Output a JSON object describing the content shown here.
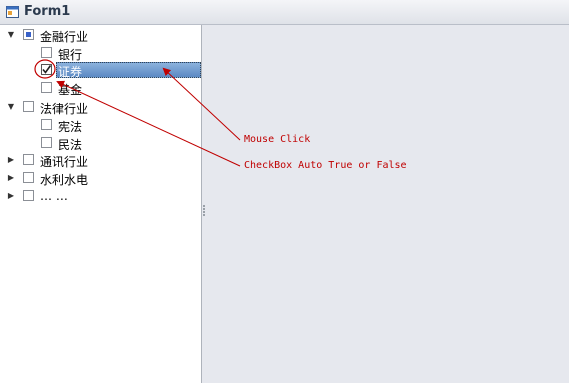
{
  "window": {
    "title": "Form1"
  },
  "tree": {
    "nodes": [
      {
        "label": "金融行业",
        "level": 0,
        "expander": "▼",
        "check": "partial"
      },
      {
        "label": "银行",
        "level": 1,
        "expander": "",
        "check": "unchecked"
      },
      {
        "label": "证券",
        "level": 1,
        "expander": "",
        "check": "checked",
        "selected": true
      },
      {
        "label": "基金",
        "level": 1,
        "expander": "",
        "check": "unchecked"
      },
      {
        "label": "法律行业",
        "level": 0,
        "expander": "▼",
        "check": "unchecked"
      },
      {
        "label": "宪法",
        "level": 1,
        "expander": "",
        "check": "unchecked"
      },
      {
        "label": "民法",
        "level": 1,
        "expander": "",
        "check": "unchecked"
      },
      {
        "label": "通讯行业",
        "level": 0,
        "expander": "▶",
        "check": "unchecked"
      },
      {
        "label": "水利水电",
        "level": 0,
        "expander": "▶",
        "check": "unchecked"
      },
      {
        "label": "… …",
        "level": 0,
        "expander": "▶",
        "check": "unchecked"
      }
    ]
  },
  "annotations": {
    "mouse_click": "Mouse Click",
    "checkbox_auto": "CheckBox Auto True or False",
    "color": "#c00000"
  }
}
